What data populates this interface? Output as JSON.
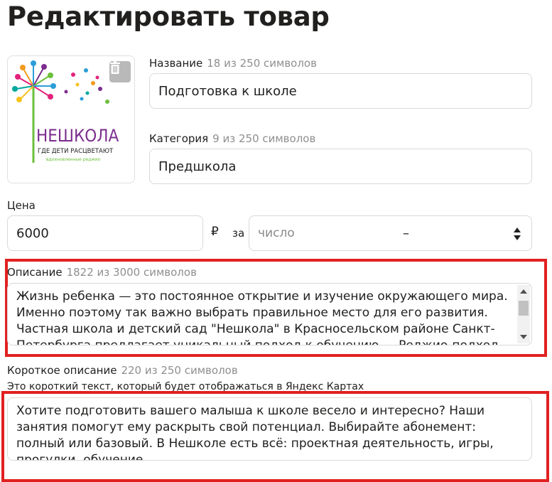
{
  "page": {
    "title": "Редактировать товар"
  },
  "photo": {
    "logo_text": "НЕШКОЛА",
    "logo_tagline": "ГДЕ ДЕТИ РАСЦВЕТАЮТ",
    "logo_subtagline": "вдохновленные реджио",
    "delete_icon": "trash-icon"
  },
  "name_field": {
    "label": "Название",
    "hint": "18 из 250 символов",
    "value": "Подготовка к школе"
  },
  "category_field": {
    "label": "Категория",
    "hint": "9 из 250 символов",
    "value": "Предшкола"
  },
  "price_field": {
    "label": "Цена",
    "value": "6000",
    "currency": "₽",
    "per_label": "за",
    "unit_placeholder": "число",
    "unit_select_value": "–"
  },
  "description_field": {
    "label": "Описание",
    "hint": "1822 из 3000 символов",
    "value": "Жизнь ребенка — это постоянное открытие и изучение окружающего мира. Именно поэтому так важно выбрать правильное место для его развития. Частная школа и детский сад \"Нешкола\" в Красносельском районе Санкт-Петербурга предлагает уникальный подход к обучению — Реджио-подход. Это",
    "scroll_position": 0.05
  },
  "short_description_field": {
    "label": "Короткое описание",
    "hint": "220 из 250 символов",
    "sub_hint": "Это короткий текст, который будет отображаться в Яндекс Картах",
    "value": "Хотите подготовить вашего малыша к школе весело и интересно? Наши занятия помогут ему раскрыть свой потенциал. Выбирайте абонемент: полный или базовый. В Нешколе есть всё: проектная деятельность, игры, прогулки, обучение"
  },
  "colors": {
    "highlight": "#e12020",
    "border": "#d9d9d9",
    "hint": "#8f8f8f",
    "logo_green": "#6cbf3a",
    "logo_purple": "#7b2d8e"
  }
}
